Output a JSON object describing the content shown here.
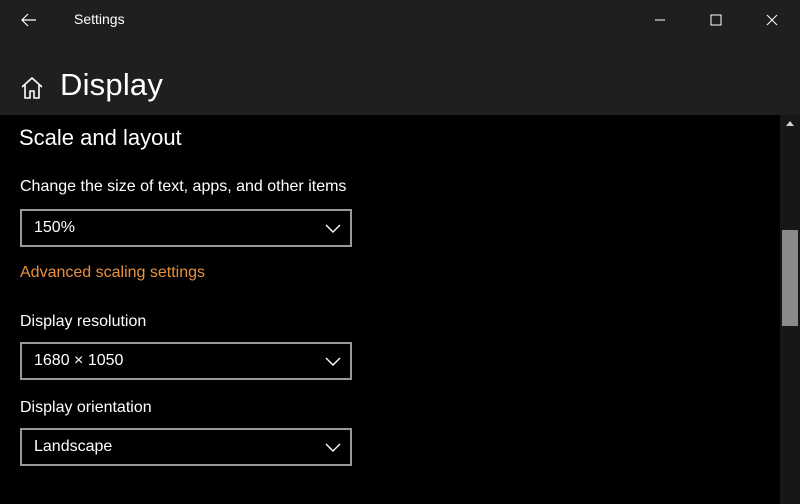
{
  "window": {
    "app_title": "Settings"
  },
  "header": {
    "title": "Display"
  },
  "section": {
    "title": "Scale and layout"
  },
  "scale": {
    "label": "Change the size of text, apps, and other items",
    "value": "150%"
  },
  "advanced_link": "Advanced scaling settings",
  "resolution": {
    "label": "Display resolution",
    "value": "1680 × 1050"
  },
  "orientation": {
    "label": "Display orientation",
    "value": "Landscape"
  },
  "colors": {
    "link": "#e8913a",
    "titlebar": "#1f1f1f",
    "background": "#000000"
  },
  "icons": [
    "back-arrow-icon",
    "minimize-icon",
    "maximize-icon",
    "close-icon",
    "home-icon",
    "chevron-down-icon",
    "scroll-up-arrow-icon"
  ]
}
